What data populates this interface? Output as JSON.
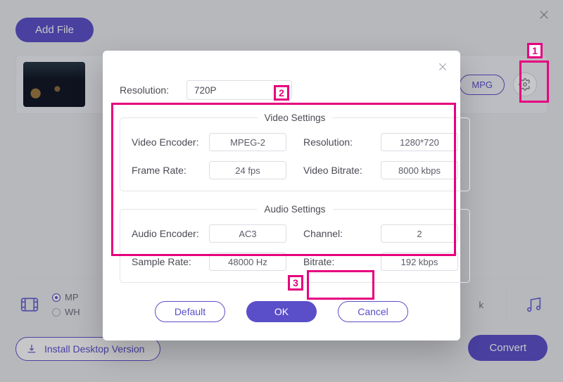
{
  "header": {
    "add_file_label": "Add File"
  },
  "file_card": {
    "format_badge": "MPG"
  },
  "bottom": {
    "install_label": "Install Desktop Version",
    "convert_label": "Convert",
    "radio_mp_label": "MP",
    "radio_wh_label": "WH",
    "spill_k": "k"
  },
  "dialog": {
    "resolution_label": "Resolution:",
    "resolution_value": "720P",
    "video_settings_legend": "Video Settings",
    "audio_settings_legend": "Audio Settings",
    "video": {
      "encoder_label": "Video Encoder:",
      "encoder_value": "MPEG-2",
      "resolution_label": "Resolution:",
      "resolution_value": "1280*720",
      "framerate_label": "Frame Rate:",
      "framerate_value": "24 fps",
      "bitrate_label": "Video Bitrate:",
      "bitrate_value": "8000 kbps"
    },
    "audio": {
      "encoder_label": "Audio Encoder:",
      "encoder_value": "AC3",
      "channel_label": "Channel:",
      "channel_value": "2",
      "samplerate_label": "Sample Rate:",
      "samplerate_value": "48000 Hz",
      "bitrate_label": "Bitrate:",
      "bitrate_value": "192 kbps"
    },
    "buttons": {
      "default": "Default",
      "ok": "OK",
      "cancel": "Cancel"
    }
  },
  "markers": {
    "m1": "1",
    "m2": "2",
    "m3": "3"
  }
}
